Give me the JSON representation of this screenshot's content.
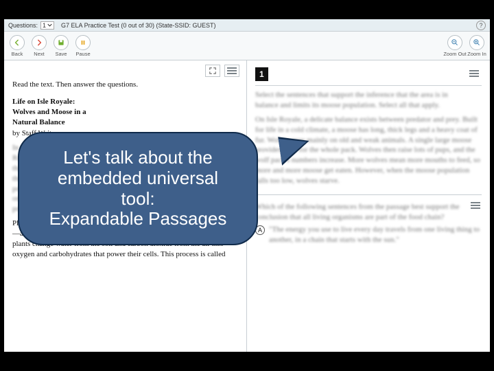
{
  "topbar": {
    "questions_label": "Questions:",
    "question_current": "1",
    "test_meta": "G7 ELA Practice Test (0 out of 30)   (State-SSID: GUEST)"
  },
  "toolbar": {
    "back": "Back",
    "next": "Next",
    "save": "Save",
    "pause": "Pause",
    "zoom_out": "Zoom Out",
    "zoom_in": "Zoom In"
  },
  "left": {
    "instructions": "Read the text. Then answer the questions.",
    "title_l1": "Life on Isle Royale:",
    "title_l2": "Wolves and Moose in a",
    "title_l3": "Natural Balance",
    "byline": "by Staff Writer",
    "p1": "In the cold waters of Lake Superior sits a long narrow island called Isle Royale. The island is covered with spruce and fir forests, and for more than sixty years scientists have carefully watched the animals that live there. What draws them is a remarkable natural experiment: a single predator, the gray wolf, and a single large prey animal, the moose, sharing one isolated place. This long study has taught us a great deal about how predators and prey affect one another over time.",
    "p2": "Plants make their own food through a process that begins with chlorophyll—a substance that traps the energy in sunlight. This energy then helps plants change water from the soil and carbon dioxide from the air into oxygen and carbohydrates that power their cells. This process is called"
  },
  "right": {
    "q1_number": "1",
    "q1_stem_a": "Select the sentences that support the inference that the area is in",
    "q1_stem_b": "balance and limits its moose population. Select all that apply.",
    "q1_p1": "On Isle Royale, a delicate balance exists between predator and prey. Built for life in a cold climate, a moose has long, thick legs and a heavy coat of fur. Wolves prey mainly on old and weak animals. A single large moose provides food for the whole pack. Wolves then raise lots of pups, and the wolf pack's numbers increase. More wolves mean more mouths to feed, so more and more moose get eaten. However, when the moose population falls too low, wolves starve.",
    "q2_stem_a": "Which of the following sentences from the passage best support the",
    "q2_stem_b": "conclusion that all living organisms are part of the food chain?",
    "q2_choice_a_label": "A",
    "q2_choice_a": "\"The energy you use to live every day travels from one living thing to another, in a chain that starts with the sun.\""
  },
  "callout": {
    "l1": "Let's talk about the",
    "l2": "embedded universal",
    "l3": "tool:",
    "l4": "Expandable Passages"
  }
}
